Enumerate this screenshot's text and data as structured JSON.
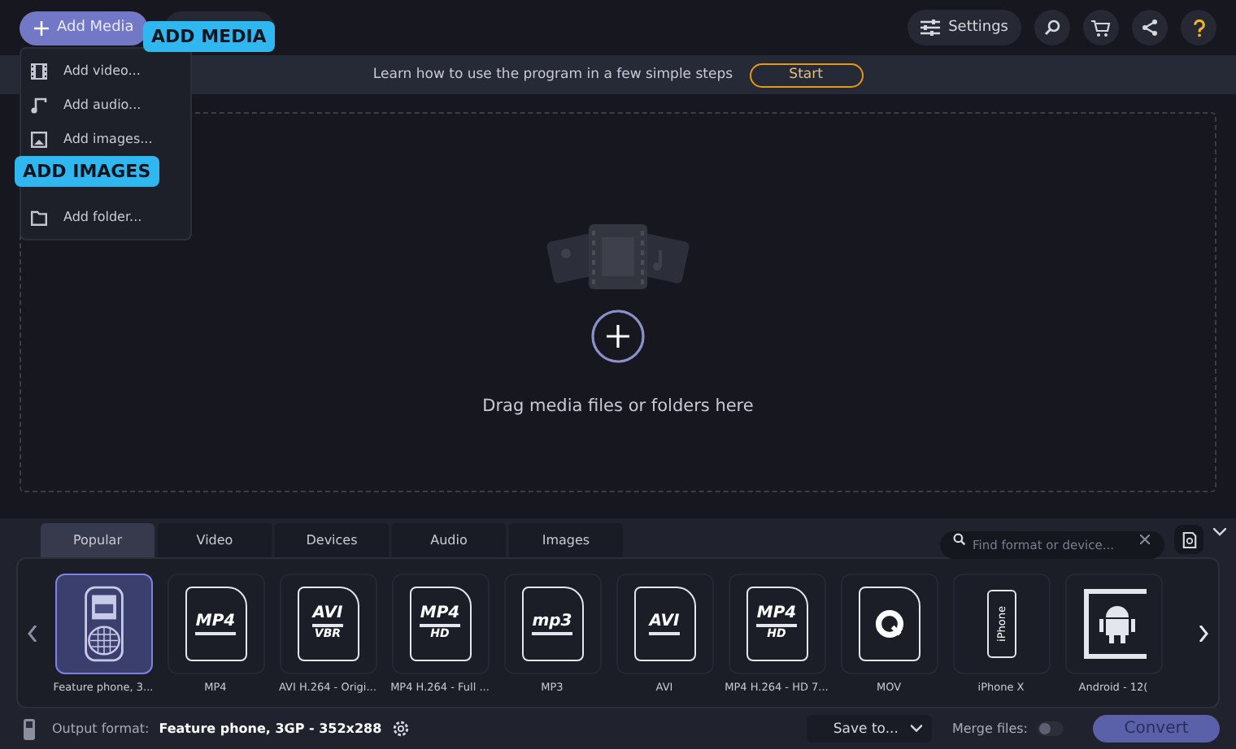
{
  "toolbar": {
    "add_media": "Add Media",
    "settings": "Settings"
  },
  "menu": {
    "items": [
      {
        "label": "Add video...",
        "kind": "video"
      },
      {
        "label": "Add audio...",
        "kind": "audio"
      },
      {
        "label": "Add images...",
        "kind": "image"
      },
      {
        "label": "Add folder...",
        "kind": "folder"
      }
    ]
  },
  "callouts": [
    "ADD MEDIA",
    "ADD IMAGES"
  ],
  "tutorial": {
    "text": "Learn how to use the program in a few simple steps",
    "button": "Start"
  },
  "drop_area": {
    "text": "Drag media files or folders here"
  },
  "format_tabs": [
    {
      "label": "Popular",
      "selected": true
    },
    {
      "label": "Video",
      "selected": false
    },
    {
      "label": "Devices",
      "selected": false
    },
    {
      "label": "Audio",
      "selected": false
    },
    {
      "label": "Images",
      "selected": false
    }
  ],
  "search": {
    "placeholder": "Find format or device..."
  },
  "formats": [
    {
      "kind": "phone",
      "label": "Feature phone, 3...",
      "selected": true
    },
    {
      "kind": "file",
      "label": "MP4",
      "lines": [
        "MP4"
      ],
      "selected": false
    },
    {
      "kind": "file",
      "label": "AVI H.264 - Origi...",
      "lines": [
        "AVI",
        "VBR"
      ],
      "selected": false
    },
    {
      "kind": "file",
      "label": "MP4 H.264 - Full ...",
      "lines": [
        "MP4",
        "HD"
      ],
      "selected": false
    },
    {
      "kind": "file",
      "label": "MP3",
      "lines": [
        "mp3"
      ],
      "selected": false
    },
    {
      "kind": "file",
      "label": "AVI",
      "lines": [
        "AVI"
      ],
      "selected": false
    },
    {
      "kind": "file",
      "label": "MP4 H.264 - HD 7...",
      "lines": [
        "MP4",
        "HD"
      ],
      "selected": false
    },
    {
      "kind": "mov",
      "label": "MOV",
      "selected": false
    },
    {
      "kind": "iphone",
      "label": "iPhone X",
      "lines": [
        "iPhone"
      ],
      "selected": false
    },
    {
      "kind": "android",
      "label": "Android - 12(",
      "selected": false
    }
  ],
  "footer": {
    "output_label": "Output format:",
    "output_value": "Feature phone, 3GP - 352x288",
    "save_to": "Save to...",
    "merge_label": "Merge files:",
    "merge_on": false,
    "convert": "Convert"
  }
}
